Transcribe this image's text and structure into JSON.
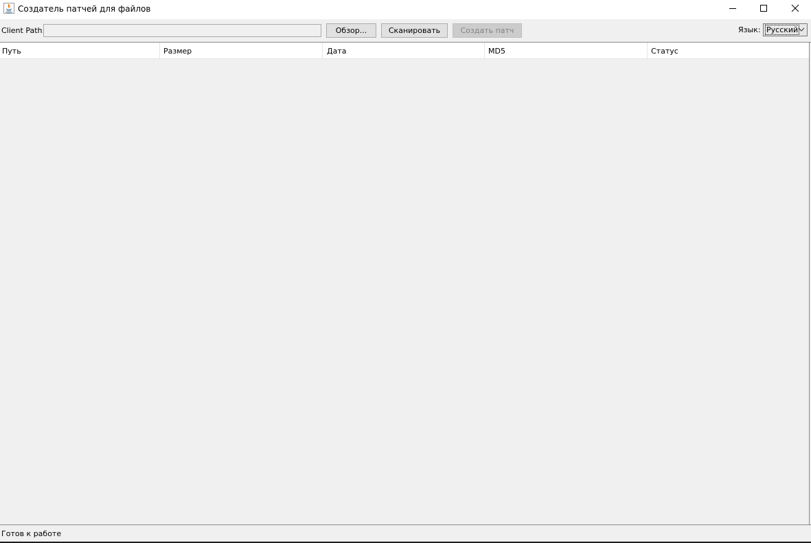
{
  "window": {
    "title": "Создатель патчей для файлов",
    "icon": "java-icon",
    "controls": [
      "minimize-icon",
      "maximize-icon",
      "close-icon"
    ]
  },
  "toolbar": {
    "client_path_label": "Client Path:",
    "client_path_value": "",
    "browse_label": "Обзор...",
    "scan_label": "Сканировать",
    "create_patch_label": "Создать патч",
    "create_patch_enabled": false,
    "language_label": "Язык:",
    "language_value": "Русский"
  },
  "table": {
    "columns": [
      "Путь",
      "Размер",
      "Дата",
      "MD5",
      "Статус"
    ],
    "rows": []
  },
  "status": {
    "text": "Готов к работе"
  }
}
